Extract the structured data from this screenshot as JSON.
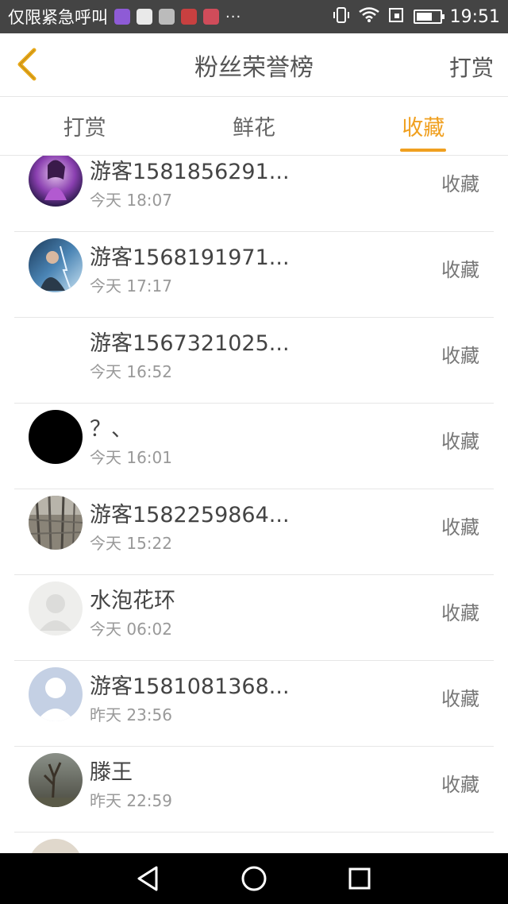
{
  "status_bar": {
    "carrier": "仅限紧急呼叫",
    "time": "19:51",
    "dots": "···",
    "app_icons": [
      "#8e5bd6",
      "#e9e9e9",
      "#bbbbbb",
      "#c84040",
      "#d04c5a"
    ]
  },
  "header": {
    "title": "粉丝荣誉榜",
    "action": "打赏"
  },
  "tabs": [
    {
      "label": "打赏",
      "active": false
    },
    {
      "label": "鲜花",
      "active": false
    },
    {
      "label": "收藏",
      "active": true
    }
  ],
  "colors": {
    "accent": "#f0a020",
    "text_primary": "#444444",
    "text_secondary": "#999999",
    "divider": "#e6e6e6"
  },
  "fans": [
    {
      "name": "游客1581856291...",
      "time": "今天 18:07",
      "type": "收藏",
      "avatar": "purple-character"
    },
    {
      "name": "游客1568191971...",
      "time": "今天 17:17",
      "type": "收藏",
      "avatar": "blue-warrior"
    },
    {
      "name": "游客1567321025...",
      "time": "今天 16:52",
      "type": "收藏",
      "avatar": "none"
    },
    {
      "name": "？、",
      "time": "今天 16:01",
      "type": "收藏",
      "avatar": "black"
    },
    {
      "name": "游客1582259864...",
      "time": "今天 15:22",
      "type": "收藏",
      "avatar": "industrial-photo"
    },
    {
      "name": "水泡花环",
      "time": "今天 06:02",
      "type": "收藏",
      "avatar": "grey-default"
    },
    {
      "name": "游客1581081368...",
      "time": "昨天 23:56",
      "type": "收藏",
      "avatar": "blue-default"
    },
    {
      "name": "滕王",
      "time": "昨天 22:59",
      "type": "收藏",
      "avatar": "nature-photo"
    }
  ]
}
